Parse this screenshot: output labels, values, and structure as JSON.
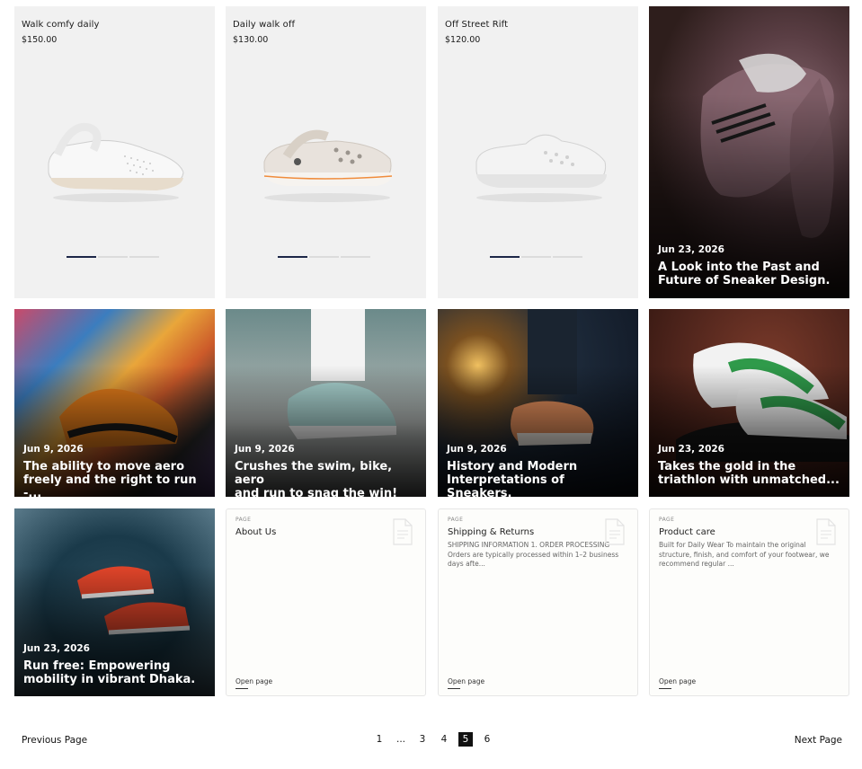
{
  "products": [
    {
      "name": "Walk comfy daily",
      "price": "$150.00",
      "icon": "clog-shoe-image"
    },
    {
      "name": "Daily walk off",
      "price": "$130.00",
      "icon": "clog-shoe-image"
    },
    {
      "name": "Off Street Rift",
      "price": "$120.00",
      "icon": "clog-shoe-image"
    }
  ],
  "blogs": [
    {
      "date": "Jun 23, 2026",
      "title_line1": "A Look into the Past and",
      "title_line2": "Future of Sneaker Design."
    },
    {
      "date": "Jun 9, 2026",
      "title_line1": "The ability to move aero",
      "title_line2": "freely and the right to run -..."
    },
    {
      "date": "Jun 9, 2026",
      "title_line1": "Crushes the swim, bike, aero",
      "title_line2": "and run to snag the win!"
    },
    {
      "date": "Jun 9, 2026",
      "title_line1": "History and Modern",
      "title_line2": "Interpretations of Sneakers."
    },
    {
      "date": "Jun 23, 2026",
      "title_line1": "Takes the gold in the",
      "title_line2": "triathlon with unmatched..."
    },
    {
      "date": "Jun 23, 2026",
      "title_line1": "Run free: Empowering",
      "title_line2": "mobility in vibrant Dhaka."
    }
  ],
  "pages": [
    {
      "tag": "PAGE",
      "title": "About Us",
      "desc": "",
      "open": "Open page"
    },
    {
      "tag": "PAGE",
      "title": "Shipping & Returns",
      "desc": "SHIPPING INFORMATION 1. ORDER PROCESSING Orders are typically processed within 1–2 business days afte...",
      "open": "Open page"
    },
    {
      "tag": "PAGE",
      "title": "Product care",
      "desc": "Built for Daily Wear To maintain the original structure, finish, and comfort of your footwear, we recommend regular ...",
      "open": "Open page"
    }
  ],
  "pagination": {
    "prev": "Previous Page",
    "next": "Next Page",
    "pages": [
      "1",
      "...",
      "3",
      "4",
      "5",
      "6"
    ],
    "current": "5"
  },
  "colors": {
    "accent": "#1d2748",
    "card_bg": "#f1f1f1"
  }
}
